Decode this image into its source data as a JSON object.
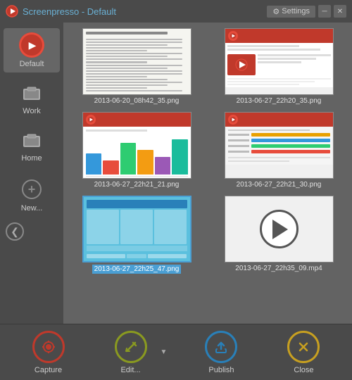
{
  "titleBar": {
    "icon": "screenpresso",
    "appName": "Screenpresso",
    "separator": " - ",
    "profileName": "Default",
    "settingsLabel": "Settings",
    "minimizeLabel": "─",
    "closeLabel": "✕"
  },
  "sidebar": {
    "items": [
      {
        "id": "default",
        "label": "Default",
        "active": true
      },
      {
        "id": "work",
        "label": "Work",
        "active": false
      },
      {
        "id": "home",
        "label": "Home",
        "active": false
      }
    ],
    "newLabel": "New...",
    "navArrow": "❮"
  },
  "content": {
    "thumbnails": [
      {
        "id": "t1",
        "filename": "2013-06-20_08h42_35.png",
        "type": "doc",
        "selected": false
      },
      {
        "id": "t2",
        "filename": "2013-06-27_22h20_35.png",
        "type": "screenpresso",
        "selected": false
      },
      {
        "id": "t3",
        "filename": "2013-06-27_22h21_21.png",
        "type": "chart",
        "selected": false
      },
      {
        "id": "t4",
        "filename": "2013-06-27_22h21_30.png",
        "type": "settings",
        "selected": false
      },
      {
        "id": "t5",
        "filename": "2013-06-27_22h25_47.png",
        "type": "dashboard",
        "selected": true
      },
      {
        "id": "t6",
        "filename": "2013-06-27_22h35_09.mp4",
        "type": "video",
        "selected": false
      }
    ]
  },
  "toolbar": {
    "captureLabel": "Capture",
    "editLabel": "Edit...",
    "publishLabel": "Publish",
    "closeLabel": "Close"
  }
}
